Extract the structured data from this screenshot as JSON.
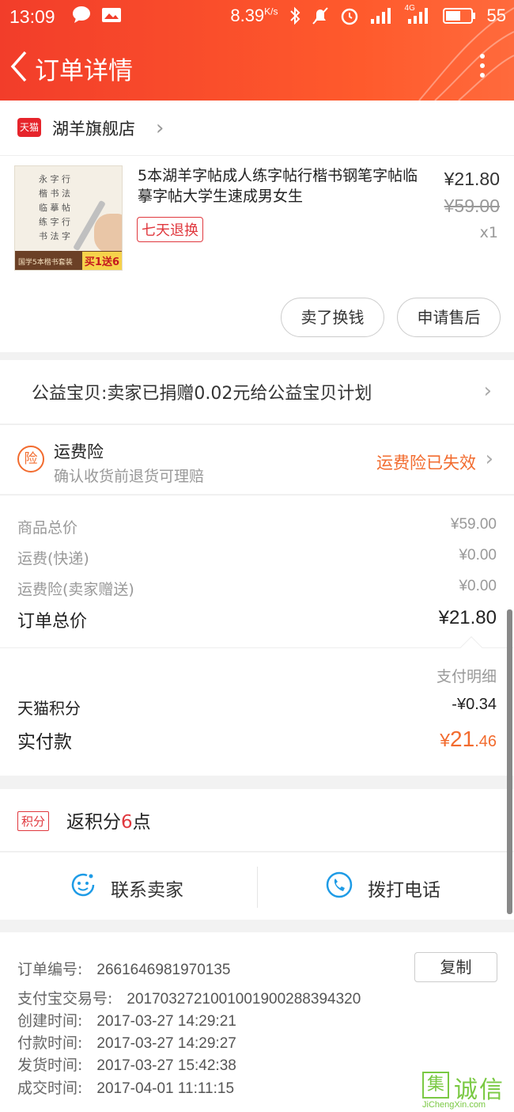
{
  "status_bar": {
    "time": "13:09",
    "speed": "8.39",
    "speed_unit": "K/s",
    "battery": "55",
    "network": "4G"
  },
  "header": {
    "title": "订单详情",
    "back_icon": "chevron-left-icon",
    "more_icon": "more-vertical-icon"
  },
  "shop": {
    "badge": "天猫",
    "name": "湖羊旗舰店"
  },
  "product": {
    "name": "5本湖羊字帖成人练字帖行楷书钢笔字帖临摹字帖大学生速成男女生",
    "return_badge": "七天退换",
    "price": "¥21.80",
    "original_price": "¥59.00",
    "quantity": "x1",
    "promo": "买1送6",
    "sell_button": "卖了换钱",
    "after_sale_button": "申请售后"
  },
  "charity": {
    "text": "公益宝贝:卖家已捐赠0.02元给公益宝贝计划"
  },
  "insurance": {
    "icon_text": "险",
    "title": "运费险",
    "subtitle": "确认收货前退货可理赔",
    "status": "运费险已失效"
  },
  "cost": {
    "goods_label": "商品总价",
    "goods_value": "¥59.00",
    "shipping_label": "运费(快递)",
    "shipping_value": "¥0.00",
    "insurance_label": "运费险(卖家赠送)",
    "insurance_value": "¥0.00",
    "total_label": "订单总价",
    "total_value": "¥21.80",
    "detail_label": "支付明细",
    "points_label": "天猫积分",
    "points_value": "-¥0.34",
    "paid_label": "实付款",
    "paid_currency": "¥",
    "paid_int": "21",
    "paid_dec": ".46"
  },
  "points": {
    "tag": "积分",
    "prefix": "返积分",
    "count": "6",
    "suffix": "点"
  },
  "contact": {
    "seller_label": "联系卖家",
    "phone_label": "拨打电话"
  },
  "order_info": {
    "order_no_label": "订单编号:",
    "order_no": "2661646981970135",
    "copy_label": "复制",
    "alipay_label": "支付宝交易号:",
    "alipay_no": "2017032721001001900288394320",
    "created_label": "创建时间:",
    "created": "2017-03-27 14:29:21",
    "paid_label": "付款时间:",
    "paid": "2017-03-27 14:29:27",
    "shipped_label": "发货时间:",
    "shipped": "2017-03-27 15:42:38",
    "done_label": "成交时间:",
    "done": "2017-04-01 11:11:15"
  },
  "watermark": {
    "char": "集",
    "text": "诚信",
    "url": "JiChengXin.com"
  },
  "colors": {
    "header": "#f23d2a",
    "accent": "#f26b2e",
    "tmall_red": "#e0383e",
    "link_blue": "#1e9be6"
  }
}
